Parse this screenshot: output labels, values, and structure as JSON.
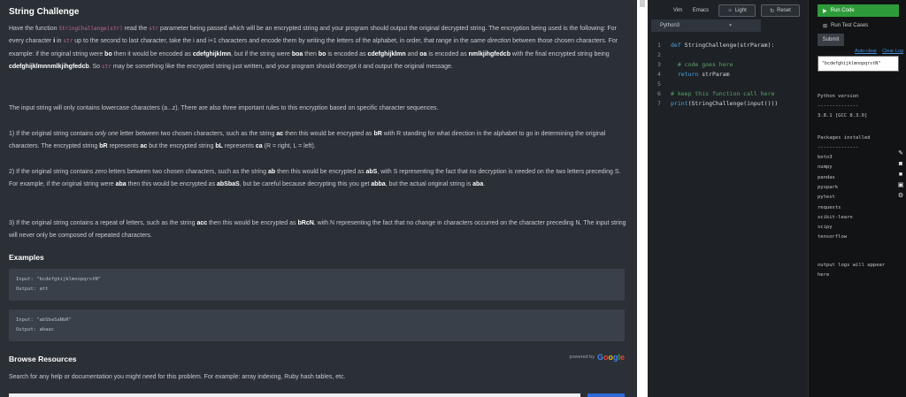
{
  "problem": {
    "title": "String Challenge",
    "intro": {
      "t1": "Have the function ",
      "fn": "StringChallenge(str)",
      "t2": " read the ",
      "str": "str",
      "t3": " parameter being passed which will be an encrypted string and your program should output the original decrypted string. The encryption being used is the following: For every character ",
      "i": "i",
      "t4": " in ",
      "t5": " up to the second to last character, take the i and i+1 characters and encode them by writing the letters of the alphabet, in order, that range in the ",
      "same": "same direction",
      "t6": " between those chosen characters. For example: if the original string were ",
      "bo": "bo",
      "t7": " then it would be encoded as ",
      "enc1": "cdefghijklmn",
      "t8": ", but if the string were ",
      "boa": "boa",
      "t9": " then ",
      "bo2": "bo",
      "t10": " is encoded as ",
      "enc2": "cdefghijklmn",
      "t11": " and ",
      "oa": "oa",
      "t12": " is encoded as ",
      "enc3": "nmlkjihgfedcb",
      "t13": " with the final encrypted string being ",
      "enc4": "cdefghijklmnnmlkjihgfedcb",
      "t14": ". So ",
      "t15": " may be something like the encrypted string just written, and your program should decrypt it and output the original message."
    },
    "rules_intro": "The input string will only contains lowercase characters (a...z). There are also three important rules to this encryption based on specific character sequences.",
    "rule1": {
      "a": "1) If the original string contains ",
      "only_one": "only one",
      "b": " letter between two chosen characters, such as the string ",
      "ac": "ac",
      "c": " then this would be encrypted as ",
      "bR": "bR",
      "d": " with R standing for what direction in the alphabet to go in determining the original characters. The encrypted string ",
      "bR2": "bR",
      "e": " represents ",
      "ac2": "ac",
      "f": " but the encrypted string ",
      "bL": "bL",
      "g": " represents ",
      "ca": "ca",
      "h": " (R = right, L = left)."
    },
    "rule2": {
      "a": "2) If the original string contains ",
      "zero": "zero",
      "b": " letters between two chosen characters, such as the string ",
      "ab": "ab",
      "c": " then this would be encrypted as ",
      "abS": "abS",
      "d": ", with S representing the fact that no decryption is needed on the two letters preceding S. For example, if the original string were ",
      "aba": "aba",
      "e": " then this would be encrypted as ",
      "abSbaS": "abSbaS",
      "f": ", but be careful because decrypting this you get ",
      "abba": "abba",
      "g": ", but the actual original string is ",
      "aba2": "aba",
      "h": "."
    },
    "rule3": {
      "a": "3) If the original string contains a repeat of letters, such as the string ",
      "acc": "acc",
      "b": " then this would be encrypted as ",
      "bRcN": "bRcN",
      "c": ", with N representing the fact that no change in characters occurred on the character preceding N. The input string will never only be composed of repeated characters."
    },
    "examples_heading": "Examples",
    "examples": [
      {
        "input": "Input: \"bcdefghijklmnopqrstN\"",
        "output": "Output: att"
      },
      {
        "input": "Input: \"abSbaSaNbR\"",
        "output": "Output: abaac"
      }
    ],
    "browse_heading": "Browse Resources",
    "powered_by": "powered by",
    "google": "Google",
    "browse_text": "Search for any help or documentation you might need for this problem. For example: array indexing, Ruby hash tables, etc."
  },
  "editor": {
    "toolbar": {
      "vim": "Vim",
      "emacs": "Emacs",
      "light": "Light",
      "reset": "Reset"
    },
    "language": "Python3",
    "lines": [
      {
        "n": "1",
        "parts": [
          {
            "c": "kw",
            "t": "def "
          },
          {
            "c": "ct",
            "t": "StringChallenge(strParam):"
          }
        ]
      },
      {
        "n": "2",
        "parts": []
      },
      {
        "n": "3",
        "parts": [
          {
            "c": "ct",
            "t": "  "
          },
          {
            "c": "cm",
            "t": "# code goes here"
          }
        ]
      },
      {
        "n": "4",
        "parts": [
          {
            "c": "ct",
            "t": "  "
          },
          {
            "c": "kw",
            "t": "return "
          },
          {
            "c": "ct",
            "t": "strParam"
          }
        ]
      },
      {
        "n": "5",
        "parts": []
      },
      {
        "n": "6",
        "parts": [
          {
            "c": "cm",
            "t": "# keep this function call here"
          }
        ]
      },
      {
        "n": "7",
        "parts": [
          {
            "c": "kw",
            "t": "print"
          },
          {
            "c": "ct",
            "t": "(StringChallenge(input()))"
          }
        ]
      }
    ]
  },
  "runner": {
    "run": "Run Code",
    "run_tests": "Run Test Cases",
    "submit": "Submit",
    "autoclear": "Auto-clear",
    "clear_log": "Clear Log",
    "test_input": "\"bcdefghijklmnopqrstN\"",
    "python_version_label": "Python version",
    "dashes": "--------------",
    "python_version": "3.8.1 [GCC 8.3.0]",
    "packages_label": "Packages installed",
    "packages": [
      "boto3",
      "numpy",
      "pandas",
      "pyspark",
      "pytest",
      "requests",
      "scikit-learn",
      "scipy",
      "tensorflow"
    ],
    "log_note": "output logs will appear\nhere"
  },
  "colors": {
    "accent": "#2e9b3a",
    "link": "#4a90d9",
    "code_pink": "#c06a8e"
  }
}
